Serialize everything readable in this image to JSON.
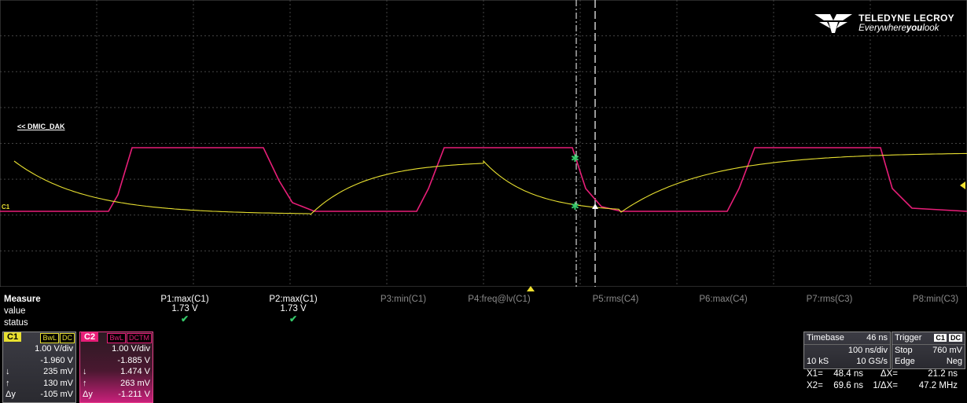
{
  "brand": {
    "name": "TELEDYNE LECROY",
    "tagline_pre": "Everywhere",
    "tagline_bold": "you",
    "tagline_post": "look"
  },
  "signal_label": "<< DMIC_DAK",
  "channel_marker": "C1",
  "measure": {
    "title": "Measure",
    "row_labels": [
      "value",
      "status"
    ],
    "columns": [
      {
        "name": "P1:max(C1)",
        "value": "1.73 V",
        "status": "ok"
      },
      {
        "name": "P2:max(C1)",
        "value": "1.73 V",
        "status": "ok"
      },
      {
        "name": "P3:min(C1)",
        "value": "",
        "status": ""
      },
      {
        "name": "P4:freq@lv(C1)",
        "value": "",
        "status": ""
      },
      {
        "name": "P5:rms(C4)",
        "value": "",
        "status": ""
      },
      {
        "name": "P6:max(C4)",
        "value": "",
        "status": ""
      },
      {
        "name": "P7:rms(C3)",
        "value": "",
        "status": ""
      },
      {
        "name": "P8:min(C3)",
        "value": "",
        "status": ""
      }
    ]
  },
  "channels": [
    {
      "name": "C1",
      "tags": [
        "BwL",
        "DC"
      ],
      "vdiv": "1.00 V/div",
      "offset": "-1.960 V",
      "down": "235 mV",
      "up": "130 mV",
      "dy": "-105 mV",
      "color": "#e8e030"
    },
    {
      "name": "C2",
      "tags": [
        "BwL",
        "DCTM"
      ],
      "vdiv": "1.00 V/div",
      "offset": "-1.885 V",
      "down": "1.474 V",
      "up": "263 mV",
      "dy": "-1.211 V",
      "color": "#e81e78"
    }
  ],
  "cursor_symbols": {
    "down": "↓",
    "up": "↑",
    "dy": "Δy"
  },
  "timebase": {
    "title": "Timebase",
    "delay": "46 ns",
    "tdiv": "100 ns/div",
    "samples": "10 kS",
    "rate": "10 GS/s"
  },
  "trigger": {
    "title": "Trigger",
    "tags": [
      "C1",
      "DC"
    ],
    "mode": "Stop",
    "level": "760 mV",
    "type": "Edge",
    "slope": "Neg"
  },
  "cursors": {
    "x1_label": "X1=",
    "x1": "48.4 ns",
    "dx_label": "ΔX=",
    "dx": "21.2 ns",
    "x2_label": "X2=",
    "x2": "69.6 ns",
    "inv_label": "1/ΔX=",
    "inv": "47.2 MHz"
  },
  "colors": {
    "c1": "#e8e030",
    "c2": "#e81e78",
    "ok": "#35c86a"
  }
}
